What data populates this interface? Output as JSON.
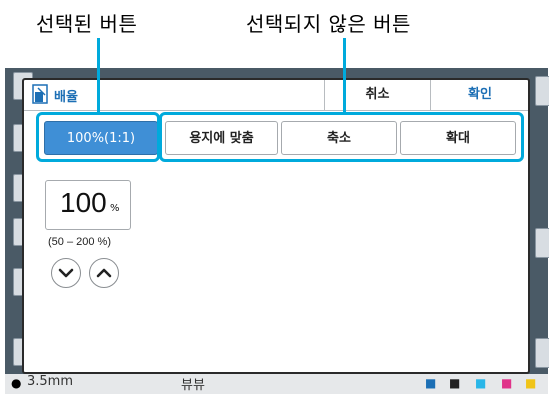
{
  "callouts": {
    "selected": "선택된 버튼",
    "unselected": "선택되지 않은 버튼"
  },
  "background": {
    "status_left": "3.5mm",
    "status_mid": "뷰뷰"
  },
  "dialog": {
    "title": "배율",
    "title_icon": "scale-page-icon",
    "cancel_label": "취소",
    "confirm_label": "확인",
    "options": [
      {
        "label": "100%(1:1)",
        "selected": true
      },
      {
        "label": "용지에 맞춤",
        "selected": false
      },
      {
        "label": "축소",
        "selected": false
      },
      {
        "label": "확대",
        "selected": false
      }
    ],
    "zoom_value": "100",
    "zoom_unit": "%",
    "zoom_range": "(50 – 200 %)",
    "decrease_icon": "chevron-down-icon",
    "increase_icon": "chevron-up-icon"
  },
  "colors": {
    "accent": "#00aadc",
    "selected_fill": "#3f8fd6",
    "title_blue": "#1c6fb5"
  }
}
